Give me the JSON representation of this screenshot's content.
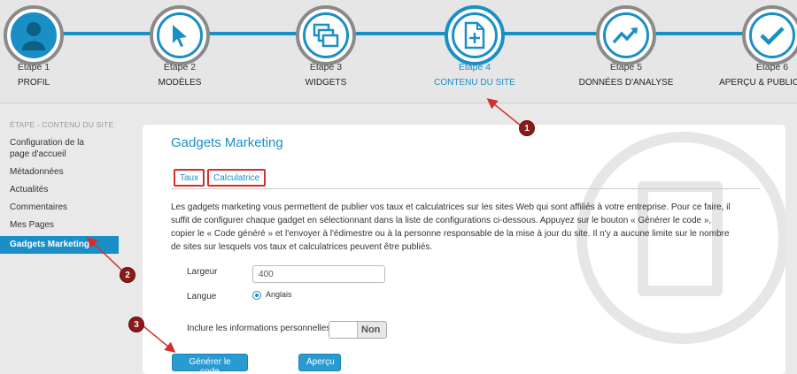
{
  "stepper": {
    "steps": [
      {
        "num": "Étape 1",
        "name": "PROFIL",
        "icon": "user-icon"
      },
      {
        "num": "Étape 2",
        "name": "MODÈLES",
        "icon": "cursor-icon"
      },
      {
        "num": "Étape 3",
        "name": "WIDGETS",
        "icon": "windows-icon"
      },
      {
        "num": "Étape 4",
        "name": "CONTENU DU SITE",
        "icon": "document-add-icon",
        "active": true
      },
      {
        "num": "Étape 5",
        "name": "DONNÉES D'ANALYSE",
        "icon": "trend-icon"
      },
      {
        "num": "Étape 6",
        "name": "APERÇU & PUBLICATION",
        "icon": "check-icon"
      }
    ]
  },
  "sidebar": {
    "heading": "ÉTAPE - CONTENU DU SITE",
    "items": [
      {
        "label": "Configuration de la page d'accueil"
      },
      {
        "label": "Métadonnées"
      },
      {
        "label": "Actualités"
      },
      {
        "label": "Commentaires"
      },
      {
        "label": "Mes Pages"
      },
      {
        "label": "Gadgets Marketing",
        "active": true
      }
    ]
  },
  "main": {
    "title": "Gadgets Marketing",
    "tabs": [
      {
        "label": "Taux"
      },
      {
        "label": "Calculatrice"
      }
    ],
    "description": "Les gadgets marketing vous permettent de publier vos taux et calculatrices sur les sites Web qui sont affiliés à votre entreprise. Pour ce faire, il suffit de configurer chaque gadget en sélectionnant dans la liste de configurations ci-dessous. Appuyez sur le bouton « Générer le code », copier le « Code généré » et l'envoyer à l'édimestre ou à la personne responsable de la mise à jour du site. Il n'y a aucune limite sur le nombre de sites sur lesquels vos taux et calculatrices peuvent être publiés.",
    "width_label": "Largeur",
    "width_value": "400",
    "language_label": "Langue",
    "language_option": "Anglais",
    "personal_info_label": "Inclure les informations personnelles",
    "toggle_value": "Non",
    "generate_button": "Générer le code",
    "preview_button": "Aperçu"
  },
  "annotations": {
    "m1": "1",
    "m2": "2",
    "m3": "3"
  },
  "colors": {
    "accent": "#1a8fc6",
    "marker": "#8b1a1a",
    "highlight": "#d32f2f"
  }
}
